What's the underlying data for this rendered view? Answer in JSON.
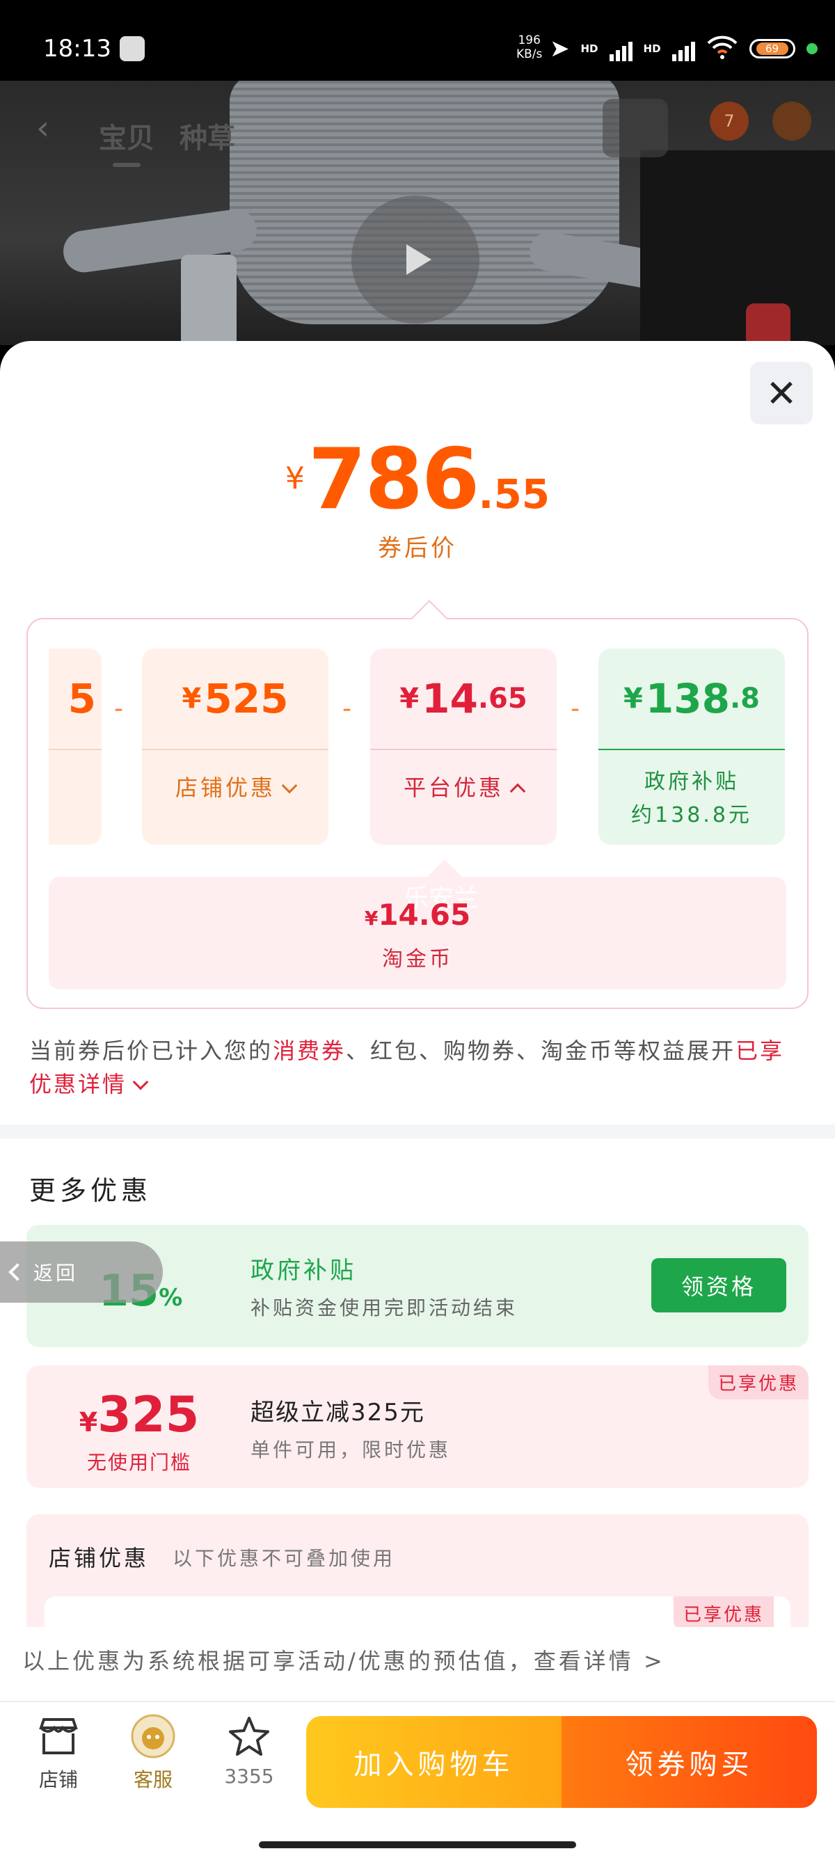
{
  "status_bar": {
    "time": "18:13",
    "net_speed_value": "196",
    "net_speed_unit": "KB/s",
    "hd1": "HD",
    "hd2": "HD",
    "battery": "69"
  },
  "hero": {
    "tab_goods": "宝贝",
    "tab_seed": "种草",
    "badge_count": "7"
  },
  "price": {
    "currency": "¥",
    "integer": "786",
    "decimal": ".55",
    "label": "券后价"
  },
  "breakdown": {
    "partial_amount": "5",
    "minus": "-",
    "shop": {
      "currency": "¥",
      "amount": "525",
      "label": "店铺优惠"
    },
    "platform": {
      "currency": "¥",
      "amount": "14",
      "decimal": ".65",
      "label": "平台优惠"
    },
    "gov": {
      "currency": "¥",
      "amount": "138",
      "decimal": ".8",
      "label": "政府补贴",
      "sub": "约138.8元"
    },
    "coin": {
      "currency": "¥",
      "amount": "14.65",
      "label": "淘金币",
      "watermark": "乐安兰"
    }
  },
  "note": {
    "part1": "当前券后价已计入您的",
    "highlight1": "消费券",
    "part2": "、红包、购物券、淘金币等权益展开",
    "highlight2": "已享优惠详情"
  },
  "more": {
    "title": "更多优惠",
    "gov": {
      "pct": "15",
      "pct_unit": "%",
      "title": "政府补贴",
      "desc": "补贴资金使用完即活动结束",
      "button": "领资格"
    },
    "super": {
      "currency": "¥",
      "amount": "325",
      "condition": "无使用门槛",
      "title": "超级立减325元",
      "desc": "单件可用，限时优惠",
      "tag": "已享优惠"
    },
    "shop": {
      "title": "店铺优惠",
      "sub": "以下优惠不可叠加使用",
      "tag": "已享优惠"
    }
  },
  "back_pill": "返回",
  "disclaimer": "以上优惠为系统根据可享活动/优惠的预估值，查看详情 >",
  "bottom": {
    "shop": "店铺",
    "service": "客服",
    "favorites": "3355",
    "add_cart": "加入购物车",
    "buy": "领券购买"
  },
  "colors": {
    "price_orange": "#ff5a00",
    "discount_red": "#e0203a",
    "gov_green": "#1ea64a"
  }
}
